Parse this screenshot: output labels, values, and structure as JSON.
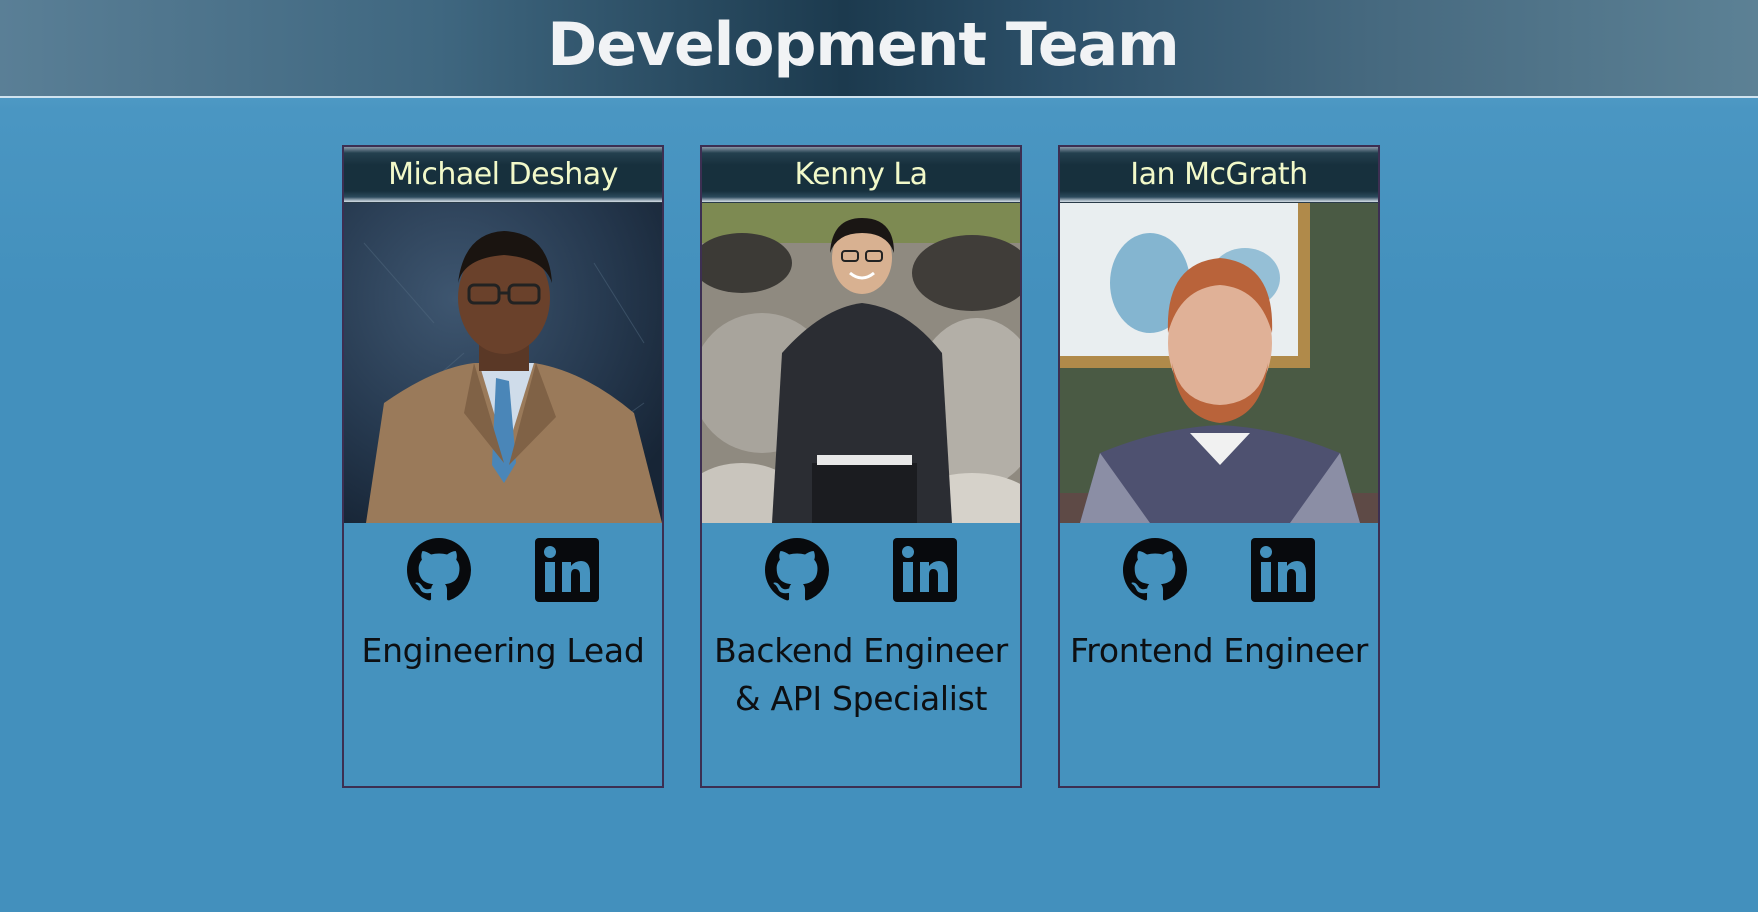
{
  "page": {
    "title": "Development Team"
  },
  "colors": {
    "background": "#4390bd",
    "name_text": "#f2f9c9",
    "card_border": "#3c2f52",
    "icon": "#080a0d"
  },
  "team": [
    {
      "name": "Michael Deshay",
      "role": "Engineering Lead",
      "links": {
        "github_icon": "github-icon",
        "linkedin_icon": "linkedin-icon"
      }
    },
    {
      "name": "Kenny La",
      "role": "Backend Engineer & API Specialist",
      "links": {
        "github_icon": "github-icon",
        "linkedin_icon": "linkedin-icon"
      }
    },
    {
      "name": "Ian McGrath",
      "role": "Frontend Engineer",
      "links": {
        "github_icon": "github-icon",
        "linkedin_icon": "linkedin-icon"
      }
    }
  ]
}
